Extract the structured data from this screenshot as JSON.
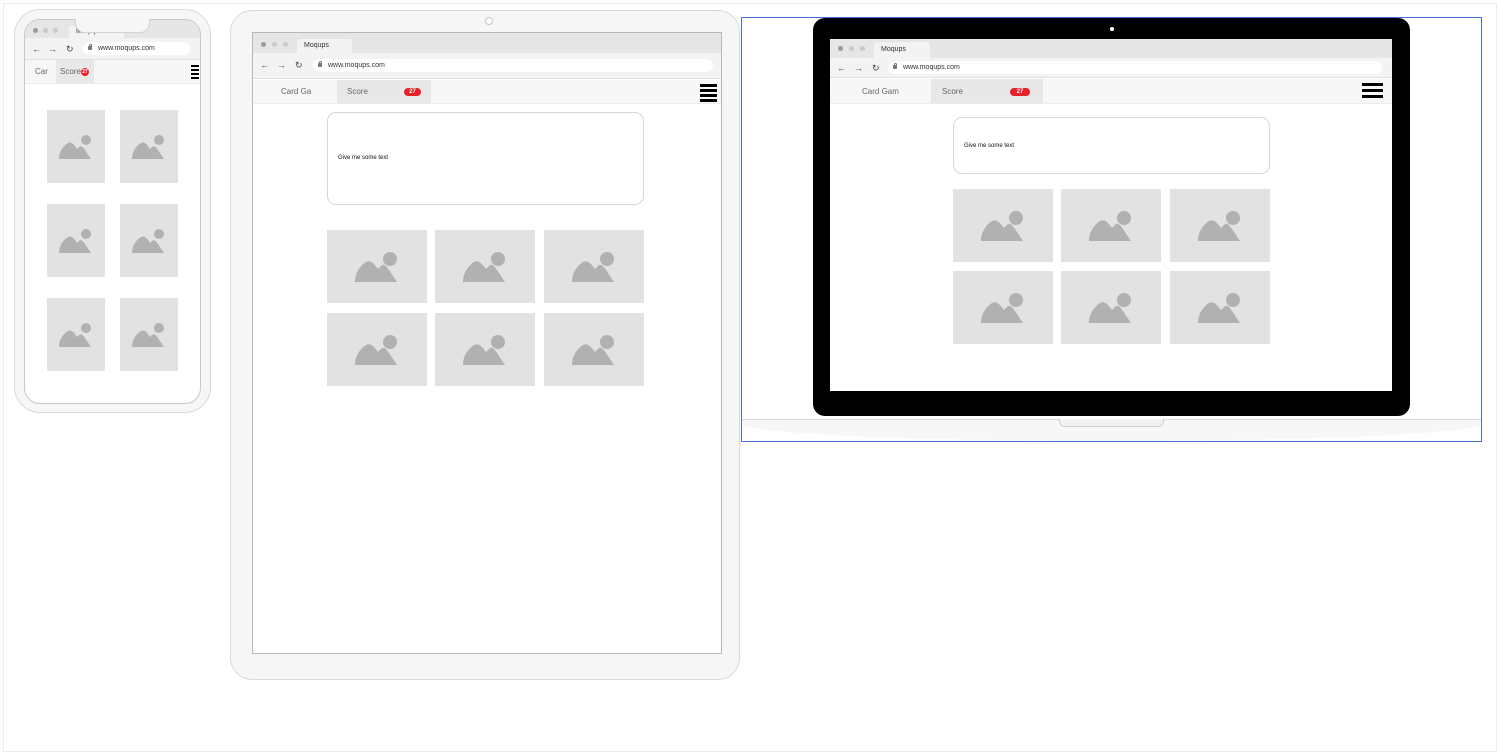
{
  "browser": {
    "tab_title": "Moqups",
    "tab_title_phone": "Moqups",
    "url": "www.moqups.com",
    "back_icon": "arrow-left-icon",
    "forward_icon": "arrow-right-icon",
    "reload_icon": "reload-icon"
  },
  "app": {
    "tab_card_game_phone": "Car",
    "tab_card_game_tablet": "Card Ga",
    "tab_card_game_laptop": "Card Gam",
    "tab_score": "Score",
    "tab_score_phone": "Score",
    "score_badge": "27",
    "menu_icon": "hamburger-menu-icon"
  },
  "content": {
    "text_box": "Give me some text",
    "image_placeholder_icon": "image-placeholder-icon"
  },
  "colors": {
    "badge": "#e8202a",
    "selection": "#4a6fd6",
    "placeholder": "#e2e2e2"
  }
}
